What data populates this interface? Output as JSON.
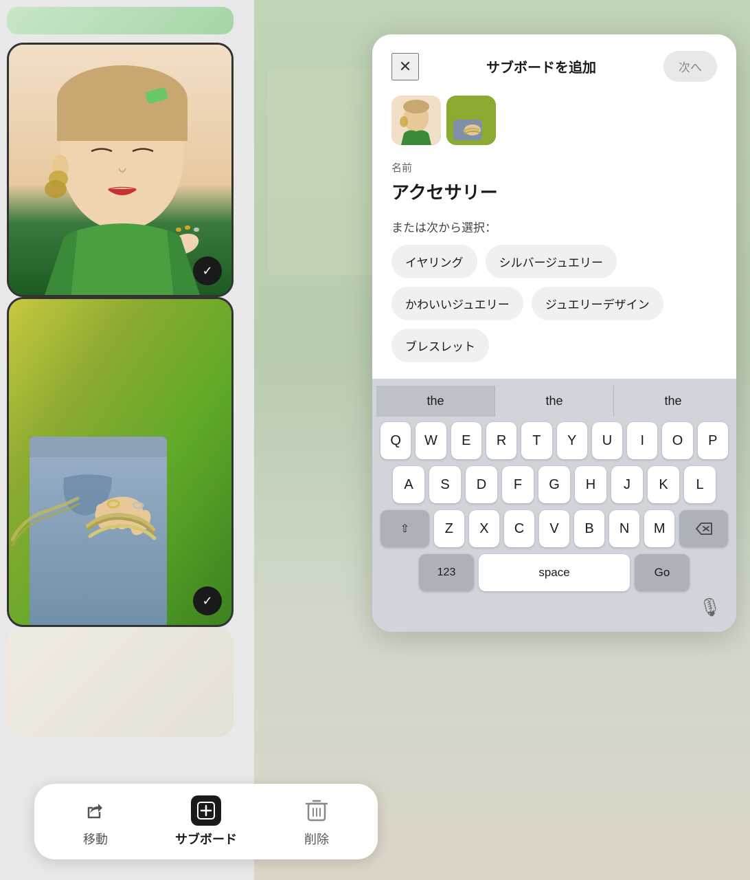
{
  "modal": {
    "title": "サブボードを追加",
    "close_label": "✕",
    "next_label": "次へ",
    "name_field_label": "名前",
    "name_field_value": "アクセサリー",
    "select_label": "または次から選択：",
    "tags": [
      "イヤリング",
      "シルバージュエリー",
      "かわいいジュエリー",
      "ジュエリーデザイン",
      "ブレスレット"
    ]
  },
  "keyboard": {
    "autocomplete": [
      "the",
      "the",
      "the"
    ],
    "rows": [
      [
        "Q",
        "W",
        "E",
        "R",
        "T",
        "Y",
        "U",
        "I",
        "O",
        "P"
      ],
      [
        "A",
        "S",
        "D",
        "F",
        "G",
        "H",
        "J",
        "K",
        "L"
      ],
      [
        "Z",
        "X",
        "C",
        "V",
        "B",
        "N",
        "M"
      ]
    ],
    "num_label": "123",
    "space_label": "space",
    "go_label": "Go"
  },
  "toolbar": {
    "move_label": "移動",
    "subboard_label": "サブボード",
    "delete_label": "削除"
  }
}
